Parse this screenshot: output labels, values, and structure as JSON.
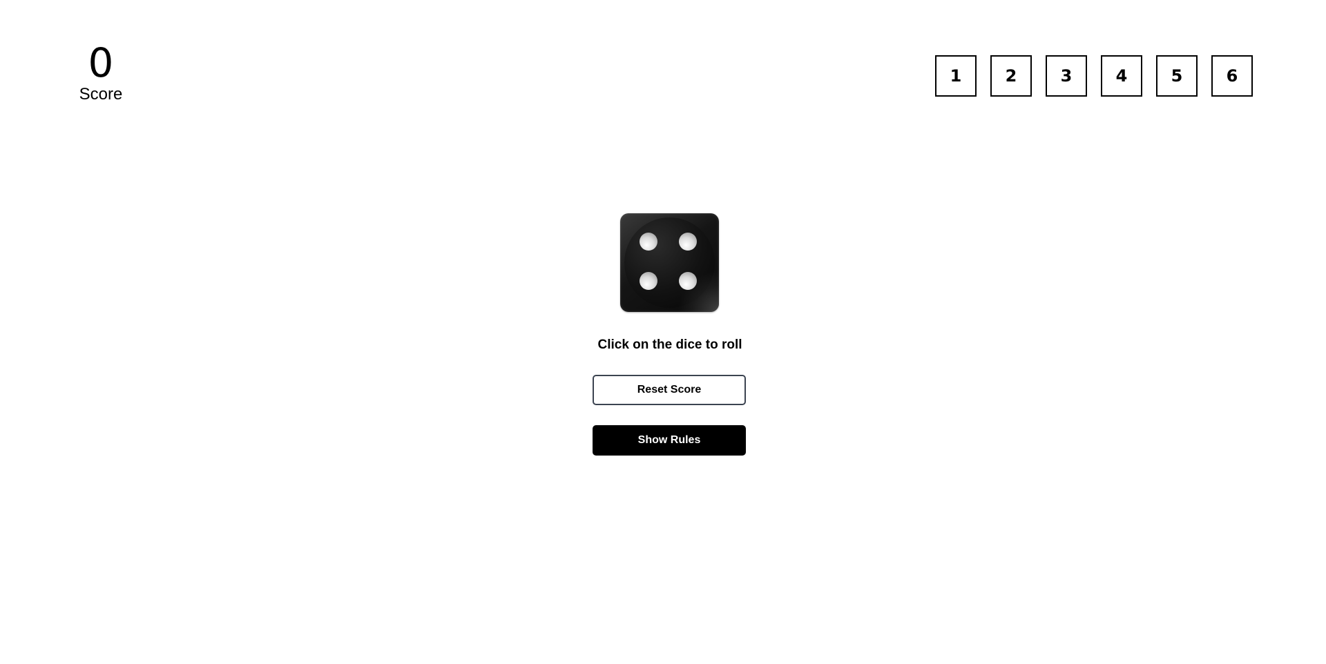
{
  "score": {
    "value": "0",
    "label": "Score"
  },
  "number_choices": [
    "1",
    "2",
    "3",
    "4",
    "5",
    "6"
  ],
  "dice": {
    "face_value": 4
  },
  "instructions": "Click on the dice to roll",
  "buttons": {
    "reset_label": "Reset Score",
    "rules_label": "Show Rules"
  },
  "colors": {
    "background": "#ffffff",
    "dice": "#111111",
    "primary_button": "#000000",
    "reset_border": "#3b4350"
  }
}
